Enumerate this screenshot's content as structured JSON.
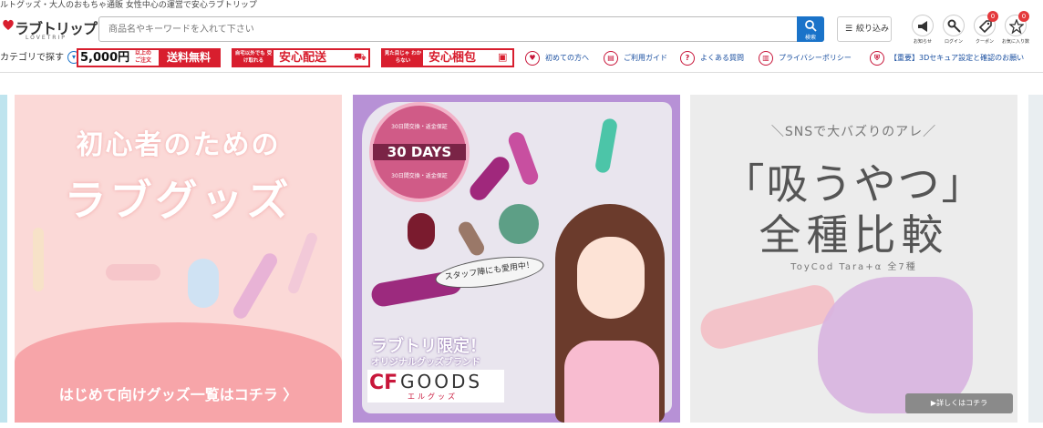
{
  "tagline": "ルトグッズ・大人のおもちゃ通販 女性中心の運営で安心ラブトリップ",
  "logo": {
    "text": "ラブトリップ",
    "sub": "LOVETRIP"
  },
  "search": {
    "placeholder": "商品名やキーワードを入れて下さい",
    "value": "",
    "button_label": "検索"
  },
  "filter_label": "絞り込み",
  "header_icons": [
    {
      "name": "news",
      "label": "お知らせ",
      "icon": "megaphone-icon",
      "badge": ""
    },
    {
      "name": "login",
      "label": "ログイン",
      "icon": "key-icon",
      "badge": ""
    },
    {
      "name": "coupon",
      "label": "クーポン",
      "icon": "tag-icon",
      "badge": "0"
    },
    {
      "name": "favorites",
      "label": "お気に入り数",
      "icon": "star-icon",
      "badge": "0"
    }
  ],
  "category_label": "カテゴリで探す",
  "promos": {
    "free_shipping": {
      "amount": "5,000円",
      "small": "以上の ご注文",
      "text": "送料無料"
    },
    "safe_delivery": {
      "small": "自宅以外でも 受け取れる",
      "text": "安心配送"
    },
    "safe_packing": {
      "small": "見た目じゃ わからない",
      "text": "安心梱包"
    }
  },
  "links": [
    {
      "label": "初めての方へ",
      "icon": "beginner-icon"
    },
    {
      "label": "ご利用ガイド",
      "icon": "guide-icon"
    },
    {
      "label": "よくある質問",
      "icon": "question-icon"
    },
    {
      "label": "プライバシーポリシー",
      "icon": "privacy-icon"
    },
    {
      "label": "【重要】3Dセキュア設定と確認のお願い",
      "icon": "shield-icon"
    }
  ],
  "slides": {
    "beginner": {
      "title1": "初心者のための",
      "title2": "ラブグッズ",
      "link": "はじめて向けグッズ一覧はコチラ 〉"
    },
    "goods": {
      "seal_main": "30 DAYS",
      "seal_top": "30日間交換・返金保証",
      "seal_bottom": "30日間交換・返金保証",
      "bubble": "スタッフ陣にも愛用中！",
      "limited": "ラブトリ限定！",
      "brand_sub": "オリジナルグッズブランド",
      "brand": "GOODS",
      "brand_logo": "CF",
      "brand_kana": "エルグッズ"
    },
    "compare": {
      "t1": "＼SNSで大バズりのアレ／",
      "t2": "「吸うやつ」",
      "t3": "全種比較",
      "t4": "ToyCod Tara+α 全7種",
      "button": "▶詳しくはコチラ"
    }
  },
  "colors": {
    "brand_red": "#d81e2e",
    "link_blue": "#1a4fa0",
    "search_blue": "#1a73c9",
    "badge_red": "#e4393c"
  }
}
